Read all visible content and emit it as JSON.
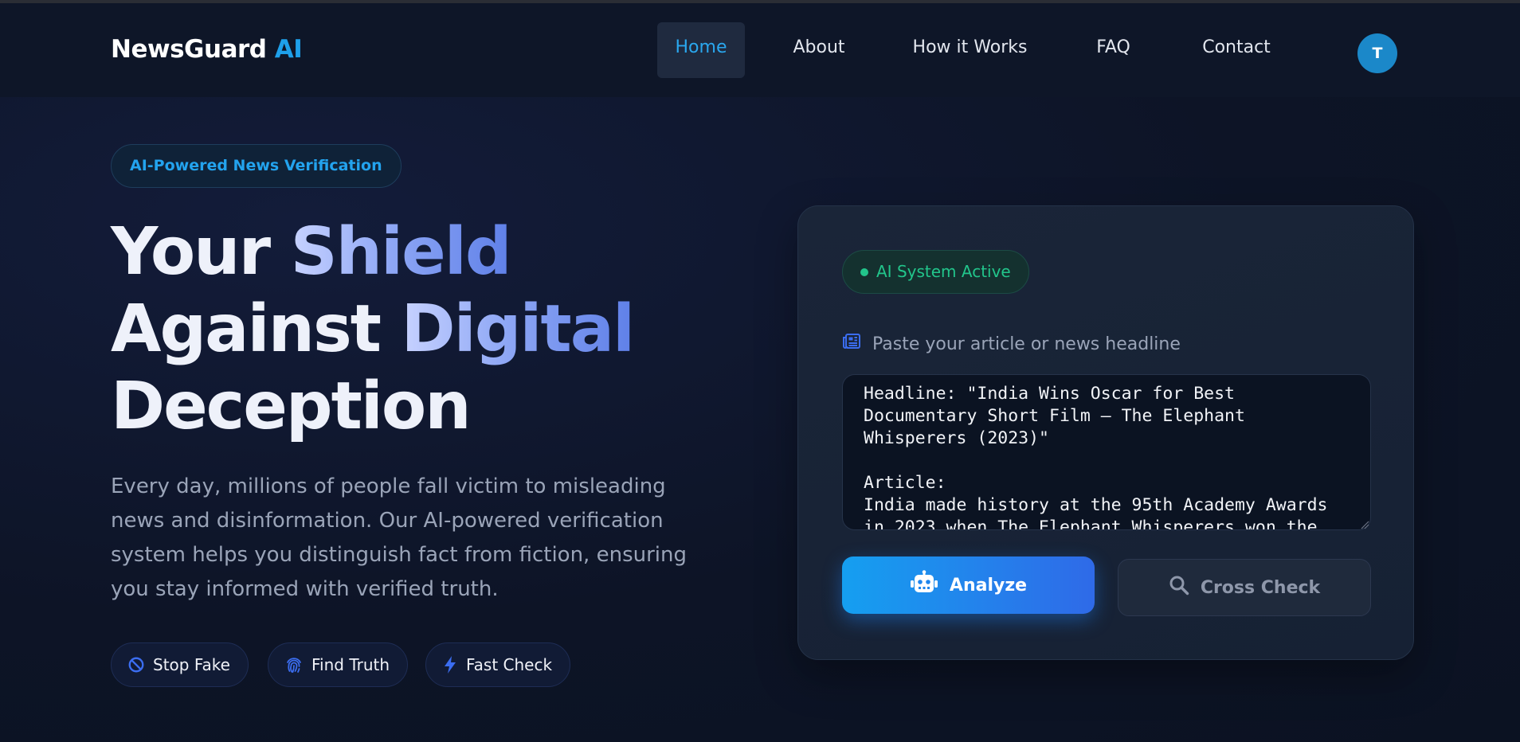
{
  "nav": {
    "logo_main": "NewsGuard",
    "logo_accent": "AI",
    "links": [
      "Home",
      "About",
      "How it Works",
      "FAQ",
      "Contact"
    ],
    "active": "Home",
    "avatar_initial": "T"
  },
  "hero": {
    "badge": "AI-Powered News Verification",
    "headline": {
      "line1_a": "Your",
      "line1_b": "Shield",
      "line2_a": "Against",
      "line2_b": "Digital",
      "line3": "Deception"
    },
    "description": "Every day, millions of people fall victim to misleading news and disinformation. Our AI-powered verification system helps you distinguish fact from fiction, ensuring you stay informed with verified truth.",
    "chips": [
      {
        "label": "Stop Fake",
        "icon": "ban-icon"
      },
      {
        "label": "Find Truth",
        "icon": "fingerprint-icon"
      },
      {
        "label": "Fast Check",
        "icon": "bolt-icon"
      }
    ]
  },
  "card": {
    "status": "AI System Active",
    "input_label": "Paste your article or news headline",
    "input_value": "Headline: \"India Wins Oscar for Best Documentary Short Film – The Elephant Whisperers (2023)\"\n\nArticle:\nIndia made history at the 95th Academy Awards in 2023 when The Elephant Whisperers won the",
    "analyze_label": "Analyze",
    "cross_check_label": "Cross Check"
  },
  "colors": {
    "accent": "#1ea0ea",
    "status_green": "#22c58b",
    "background": "#0d1426"
  }
}
